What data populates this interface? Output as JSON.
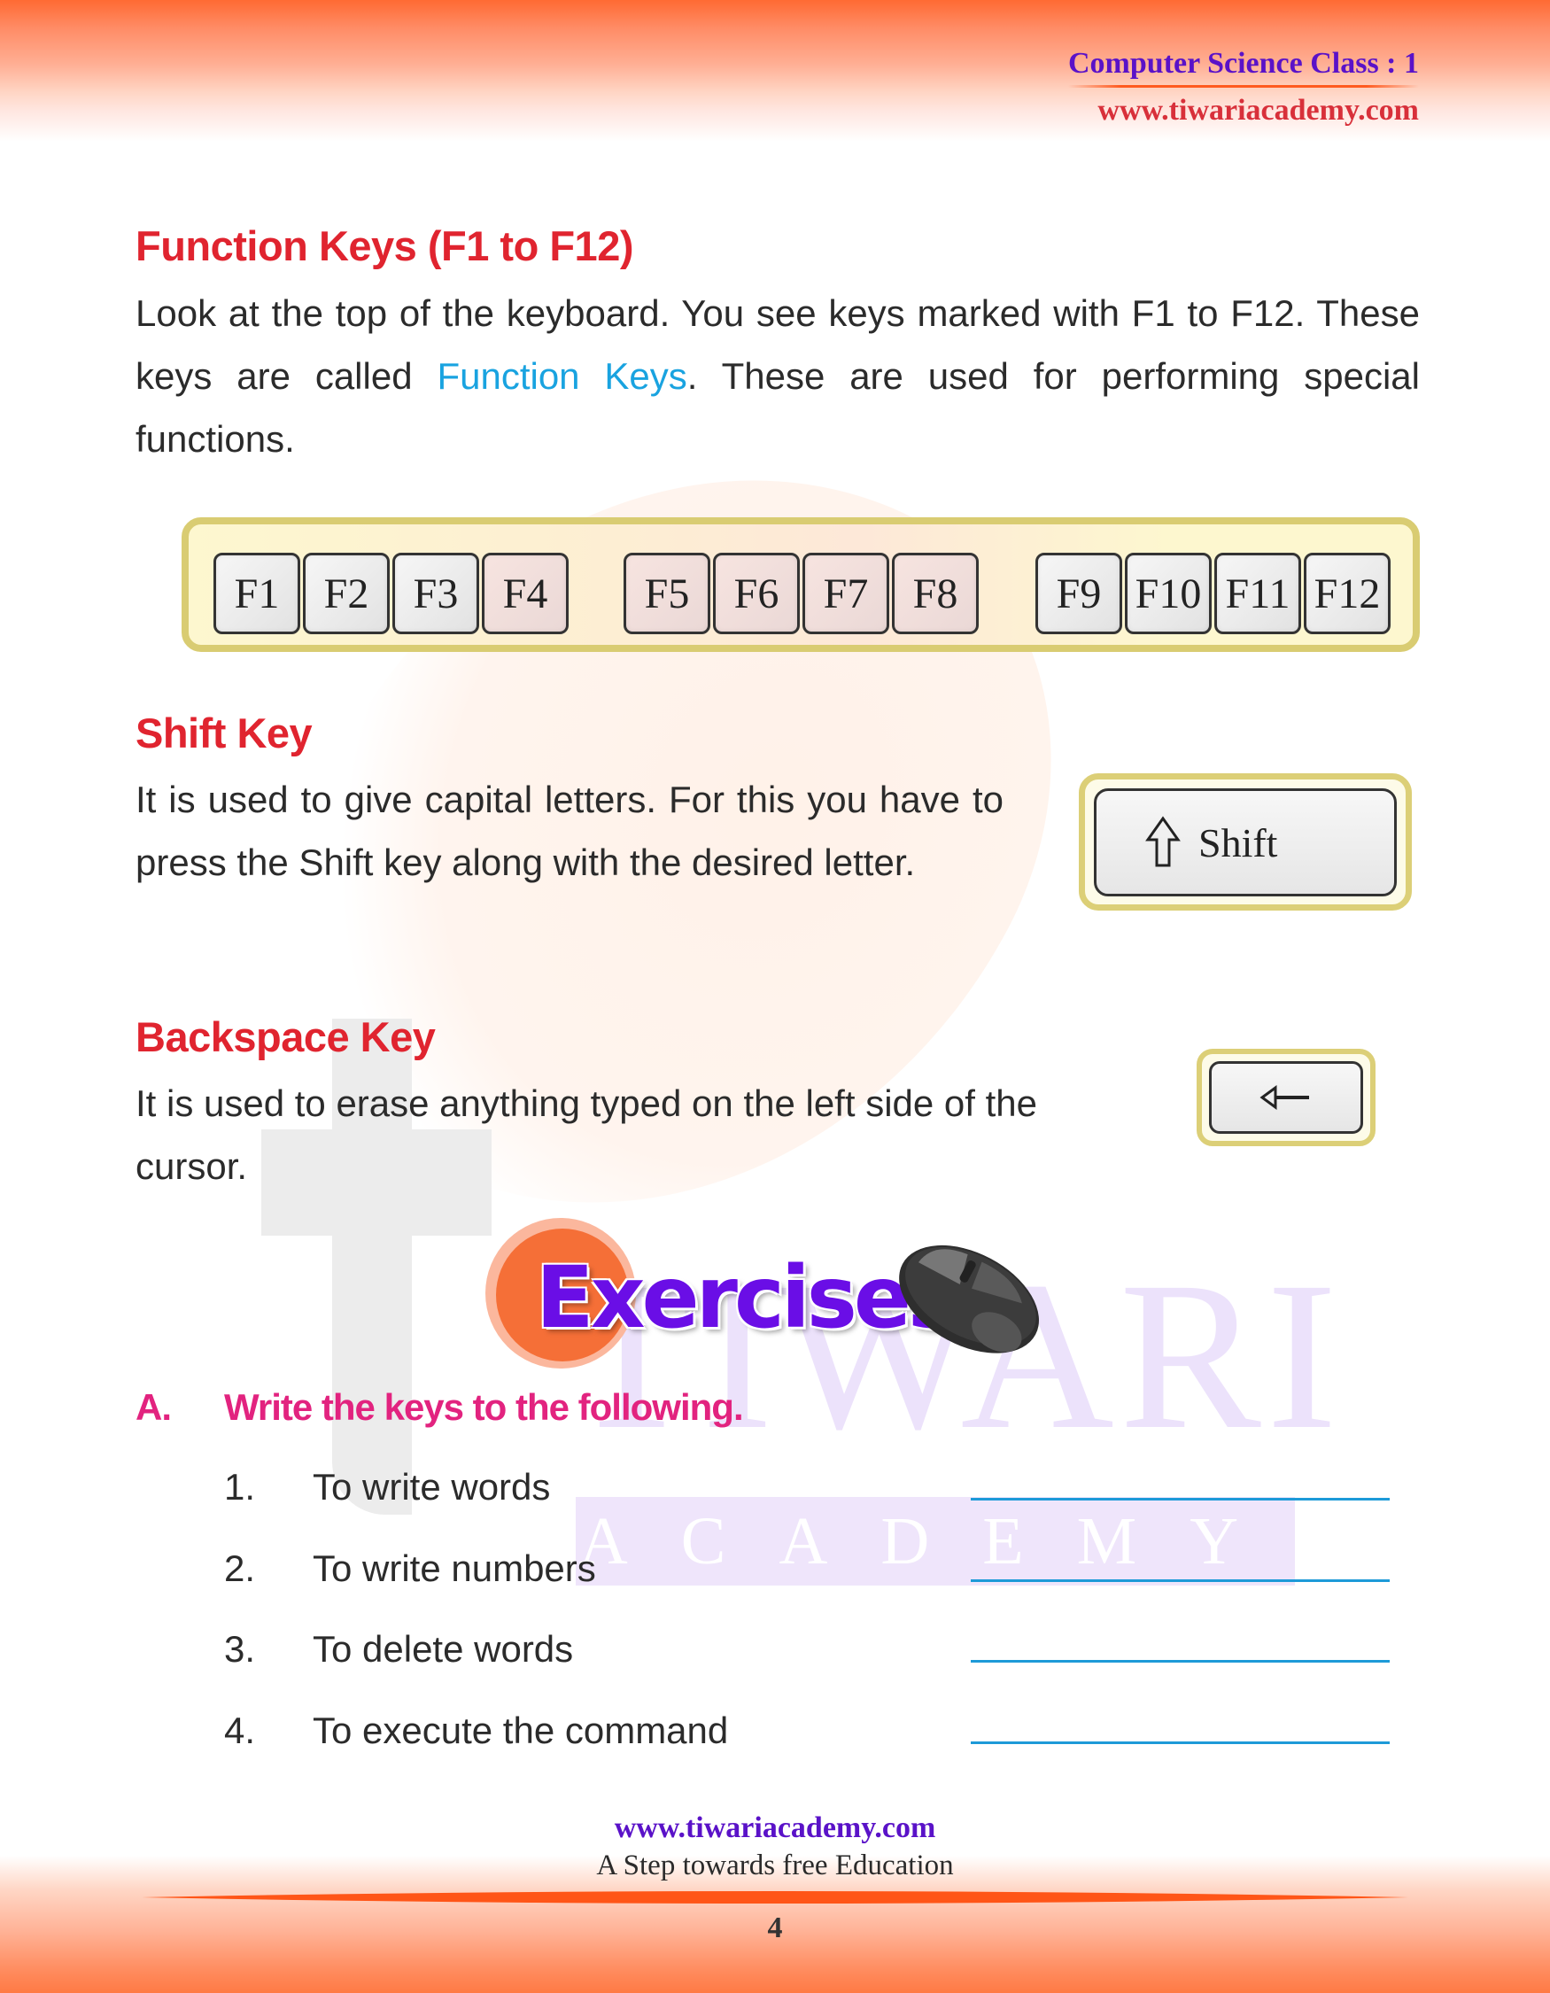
{
  "header": {
    "title": "Computer Science Class : 1",
    "url": "www.tiwariacademy.com"
  },
  "watermark": {
    "word1": "TIWARI",
    "word2": "ACADEMY"
  },
  "function_keys": {
    "heading": "Function Keys (F1 to F12)",
    "para_before": "Look at the top of the keyboard. You see keys marked with F1 to F12. These keys are called ",
    "para_highlight": "Function Keys",
    "para_after": ". These are used for performing special functions.",
    "groups": [
      [
        "F1",
        "F2",
        "F3",
        "F4"
      ],
      [
        "F5",
        "F6",
        "F7",
        "F8"
      ],
      [
        "F9",
        "F10",
        "F11",
        "F12"
      ]
    ]
  },
  "shift_key": {
    "heading": "Shift Key",
    "paragraph": "It is used to give capital letters. For this you have to press the Shift key along with the desired letter.",
    "key_label": "Shift",
    "key_icon": "up-arrow-outline-icon"
  },
  "backspace_key": {
    "heading": "Backspace Key",
    "paragraph": "It is used to erase anything typed on the left side of the cursor.",
    "key_icon": "left-arrow-icon"
  },
  "exercises": {
    "title": "Exercises",
    "section_letter": "A.",
    "section_title": "Write the keys to the following.",
    "questions": [
      {
        "num": "1.",
        "text": "To write words",
        "answer": ""
      },
      {
        "num": "2.",
        "text": "To write numbers",
        "answer": ""
      },
      {
        "num": "3.",
        "text": "To delete words",
        "answer": ""
      },
      {
        "num": "4.",
        "text": "To execute the command",
        "answer": ""
      }
    ]
  },
  "footer": {
    "url": "www.tiwariacademy.com",
    "tagline": "A Step towards free Education",
    "page_number": "4"
  },
  "colors": {
    "heading_red": "#e0242f",
    "highlight_blue": "#19a3e0",
    "exercise_pink": "#e2237f",
    "brand_purple": "#5a12c8",
    "accent_orange": "#ff6a33",
    "key_frame_yellow": "#d9cc72"
  }
}
